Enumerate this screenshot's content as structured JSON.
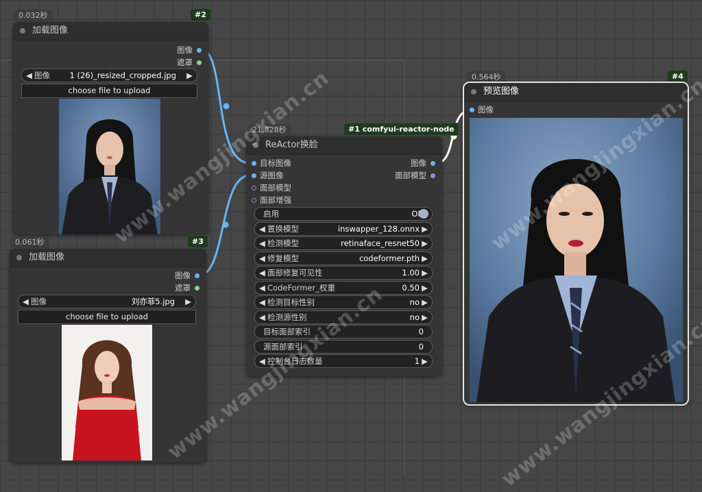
{
  "nodes": {
    "load1": {
      "time": "0.032秒",
      "id": "#2",
      "title": "加载图像",
      "outputs": [
        "图像",
        "遮罩"
      ],
      "image_label": "图像",
      "image_value": "1 (26)_resized_cropped.jpg",
      "upload_label": "choose file to upload"
    },
    "load2": {
      "time": "0.061秒",
      "id": "#3",
      "title": "加载图像",
      "outputs": [
        "图像",
        "遮罩"
      ],
      "image_label": "图像",
      "image_value": "刘亦菲5.jpg",
      "upload_label": "choose file to upload"
    },
    "reactor": {
      "time": "21.828秒",
      "id": "#1 comfyui-reactor-node",
      "title": "ReActor换脸",
      "inputs": [
        "目标图像",
        "源图像",
        "面部模型",
        "面部增强"
      ],
      "outputs": [
        "图像",
        "面部模型"
      ],
      "enable": {
        "label": "启用",
        "value": "ON"
      },
      "widgets": [
        {
          "label": "置换模型",
          "value": "inswapper_128.onnx"
        },
        {
          "label": "检测模型",
          "value": "retinaface_resnet50"
        },
        {
          "label": "修复模型",
          "value": "codeformer.pth"
        },
        {
          "label": "面部修复可见性",
          "value": "1.00"
        },
        {
          "label": "CodeFormer_权重",
          "value": "0.50"
        },
        {
          "label": "检测目标性别",
          "value": "no"
        },
        {
          "label": "检测源性别",
          "value": "no"
        }
      ],
      "plain_widgets": [
        {
          "label": "目标面部索引",
          "value": "0"
        },
        {
          "label": "源面部索引",
          "value": "0"
        }
      ],
      "log_widget": {
        "label": "控制台日志数量",
        "value": "1"
      }
    },
    "preview": {
      "time": "0.564秒",
      "id": "#4",
      "title": "预览图像",
      "inputs": [
        "图像"
      ]
    }
  },
  "watermark": "www.wangjingxian.cn",
  "colors": {
    "image_link": "#64b5f6",
    "mask_socket": "#8bd38b",
    "face_model_socket": "#9e8bd3",
    "id_badge_bg": "#1f3a1f"
  }
}
